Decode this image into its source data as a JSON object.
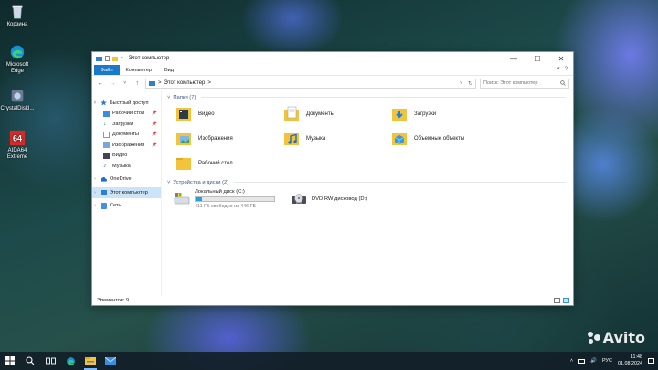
{
  "desktop": {
    "icons": [
      {
        "label": "Корзина",
        "icon": "recycle-bin-icon"
      },
      {
        "label": "Microsoft Edge",
        "icon": "edge-icon"
      },
      {
        "label": "CrystalDiskI...",
        "icon": "crystaldisk-icon"
      },
      {
        "label": "AIDA64 Extreme",
        "icon": "aida64-icon",
        "badge": "64"
      }
    ]
  },
  "window": {
    "title": "Этот компьютер",
    "controls": {
      "minimize": "—",
      "maximize": "☐",
      "close": "✕"
    },
    "ribbon": {
      "tabs": [
        "Файл",
        "Компьютер",
        "Вид"
      ],
      "expand": "˅",
      "help": "?"
    },
    "address": {
      "path": "Этот компьютер",
      "separator": ">",
      "refresh": "↻",
      "dropdown": "˅"
    },
    "search": {
      "placeholder": "Поиск: Этот компьютер",
      "icon": "search-icon"
    },
    "nav": {
      "quick_access": "Быстрый доступ",
      "pinned": [
        "Рабочий стол",
        "Загрузки",
        "Документы",
        "Изображения"
      ],
      "unpinned": [
        "Видео",
        "Музыка"
      ],
      "onedrive": "OneDrive",
      "this_pc": "Этот компьютер",
      "network": "Сеть"
    },
    "folders_header": "Папки (7)",
    "folders": [
      {
        "name": "Видео",
        "icon": "video-folder-icon"
      },
      {
        "name": "Документы",
        "icon": "documents-folder-icon"
      },
      {
        "name": "Загрузки",
        "icon": "downloads-folder-icon"
      },
      {
        "name": "Изображения",
        "icon": "pictures-folder-icon"
      },
      {
        "name": "Музыка",
        "icon": "music-folder-icon"
      },
      {
        "name": "Объемные объекты",
        "icon": "3d-objects-folder-icon"
      },
      {
        "name": "Рабочий стол",
        "icon": "desktop-folder-icon"
      }
    ],
    "devices_header": "Устройства и диски (2)",
    "drives": [
      {
        "name": "Локальный диск (C:)",
        "free": "411 ГБ свободно из 446 ГБ",
        "used_fraction": 0.078,
        "icon": "hard-drive-icon"
      },
      {
        "name": "DVD RW дисковод (D:)",
        "icon": "dvd-drive-icon"
      }
    ],
    "status": "Элементов: 9"
  },
  "taskbar": {
    "language": "РУС",
    "time": "11:48",
    "date": "01.08.2024",
    "apps": [
      "start-icon",
      "search-icon",
      "task-view-icon",
      "edge-icon",
      "file-explorer-icon",
      "mail-icon"
    ]
  },
  "watermark": "Avito",
  "colors": {
    "accent": "#1979ca",
    "selection": "#cce4f7",
    "folder": "#f3c33c",
    "drive_bar": "#26a0da"
  }
}
